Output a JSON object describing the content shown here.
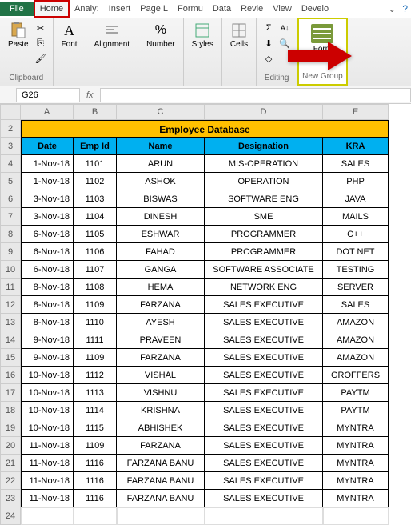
{
  "tabs": {
    "file": "File",
    "home": "Home",
    "analysis": "Analy:",
    "insert": "Insert",
    "pagel": "Page L",
    "formu": "Formu",
    "data": "Data",
    "review": "Revie",
    "view": "View",
    "develo": "Develo"
  },
  "ribbon": {
    "clipboard": {
      "label": "Clipboard",
      "paste": "Paste"
    },
    "font": {
      "label": "Font",
      "btn": "Font"
    },
    "alignment": {
      "label": "Alignment",
      "btn": "Alignment"
    },
    "number": {
      "label": "Number",
      "btn": "Number"
    },
    "styles": {
      "label": "Styles",
      "btn": "Styles"
    },
    "cells": {
      "label": "Cells",
      "btn": "Cells"
    },
    "editing": {
      "label": "Editing"
    },
    "newgroup": {
      "label": "New Group",
      "form": "Form"
    }
  },
  "namebox": "G26",
  "cols": [
    "A",
    "B",
    "C",
    "D",
    "E"
  ],
  "title": "Employee Database",
  "headers": [
    "Date",
    "Emp Id",
    "Name",
    "Designation",
    "KRA"
  ],
  "rows": [
    {
      "n": "4",
      "date": "1-Nov-18",
      "id": "1101",
      "name": "ARUN",
      "desig": "MIS-OPERATION",
      "kra": "SALES"
    },
    {
      "n": "5",
      "date": "1-Nov-18",
      "id": "1102",
      "name": "ASHOK",
      "desig": "OPERATION",
      "kra": "PHP"
    },
    {
      "n": "6",
      "date": "3-Nov-18",
      "id": "1103",
      "name": "BISWAS",
      "desig": "SOFTWARE ENG",
      "kra": "JAVA"
    },
    {
      "n": "7",
      "date": "3-Nov-18",
      "id": "1104",
      "name": "DINESH",
      "desig": "SME",
      "kra": "MAILS"
    },
    {
      "n": "8",
      "date": "6-Nov-18",
      "id": "1105",
      "name": "ESHWAR",
      "desig": "PROGRAMMER",
      "kra": "C++"
    },
    {
      "n": "9",
      "date": "6-Nov-18",
      "id": "1106",
      "name": "FAHAD",
      "desig": "PROGRAMMER",
      "kra": "DOT NET"
    },
    {
      "n": "10",
      "date": "6-Nov-18",
      "id": "1107",
      "name": "GANGA",
      "desig": "SOFTWARE ASSOCIATE",
      "kra": "TESTING"
    },
    {
      "n": "11",
      "date": "8-Nov-18",
      "id": "1108",
      "name": "HEMA",
      "desig": "NETWORK ENG",
      "kra": "SERVER"
    },
    {
      "n": "12",
      "date": "8-Nov-18",
      "id": "1109",
      "name": "FARZANA",
      "desig": "SALES EXECUTIVE",
      "kra": "SALES"
    },
    {
      "n": "13",
      "date": "8-Nov-18",
      "id": "1110",
      "name": "AYESH",
      "desig": "SALES EXECUTIVE",
      "kra": "AMAZON"
    },
    {
      "n": "14",
      "date": "9-Nov-18",
      "id": "1111",
      "name": "PRAVEEN",
      "desig": "SALES EXECUTIVE",
      "kra": "AMAZON"
    },
    {
      "n": "15",
      "date": "9-Nov-18",
      "id": "1109",
      "name": "FARZANA",
      "desig": "SALES EXECUTIVE",
      "kra": "AMAZON"
    },
    {
      "n": "16",
      "date": "10-Nov-18",
      "id": "1112",
      "name": "VISHAL",
      "desig": "SALES EXECUTIVE",
      "kra": "GROFFERS"
    },
    {
      "n": "17",
      "date": "10-Nov-18",
      "id": "1113",
      "name": "VISHNU",
      "desig": "SALES EXECUTIVE",
      "kra": "PAYTM"
    },
    {
      "n": "18",
      "date": "10-Nov-18",
      "id": "1114",
      "name": "KRISHNA",
      "desig": "SALES EXECUTIVE",
      "kra": "PAYTM"
    },
    {
      "n": "19",
      "date": "10-Nov-18",
      "id": "1115",
      "name": "ABHISHEK",
      "desig": "SALES EXECUTIVE",
      "kra": "MYNTRA"
    },
    {
      "n": "20",
      "date": "11-Nov-18",
      "id": "1109",
      "name": "FARZANA",
      "desig": "SALES EXECUTIVE",
      "kra": "MYNTRA"
    },
    {
      "n": "21",
      "date": "11-Nov-18",
      "id": "1116",
      "name": "FARZANA BANU",
      "desig": "SALES EXECUTIVE",
      "kra": "MYNTRA"
    },
    {
      "n": "22",
      "date": "11-Nov-18",
      "id": "1116",
      "name": "FARZANA BANU",
      "desig": "SALES EXECUTIVE",
      "kra": "MYNTRA"
    },
    {
      "n": "23",
      "date": "11-Nov-18",
      "id": "1116",
      "name": "FARZANA BANU",
      "desig": "SALES EXECUTIVE",
      "kra": "MYNTRA"
    }
  ],
  "extra_rows": [
    "24"
  ]
}
